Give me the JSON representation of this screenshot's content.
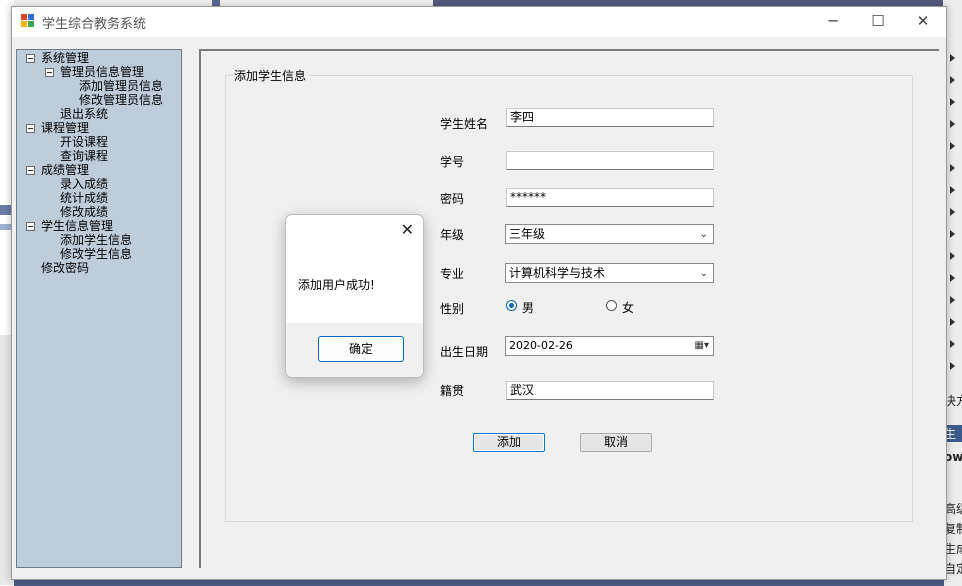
{
  "window": {
    "title": "学生综合教务系统",
    "minimize": "─",
    "maximize": "☐",
    "close": "✕"
  },
  "tree": {
    "nodes": [
      {
        "label": "系统管理"
      },
      {
        "label": "管理员信息管理"
      },
      {
        "label": "添加管理员信息"
      },
      {
        "label": "修改管理员信息"
      },
      {
        "label": "退出系统"
      },
      {
        "label": "课程管理"
      },
      {
        "label": "开设课程"
      },
      {
        "label": "查询课程"
      },
      {
        "label": "成绩管理"
      },
      {
        "label": "录入成绩"
      },
      {
        "label": "统计成绩"
      },
      {
        "label": "修改成绩"
      },
      {
        "label": "学生信息管理"
      },
      {
        "label": "添加学生信息"
      },
      {
        "label": "修改学生信息"
      },
      {
        "label": "修改密码"
      }
    ]
  },
  "form": {
    "group_title": "添加学生信息",
    "name_label": "学生姓名",
    "name_value": "李四",
    "id_label": "学号",
    "id_value": "",
    "password_label": "密码",
    "password_value": "******",
    "grade_label": "年级",
    "grade_value": "三年级",
    "major_label": "专业",
    "major_value": "计算机科学与技术",
    "gender_label": "性别",
    "gender_male": "男",
    "gender_female": "女",
    "gender_selected": "男",
    "birth_label": "出生日期",
    "birth_value": "2020-02-26",
    "origin_label": "籍贯",
    "origin_value": "武汉",
    "add_button": "添加",
    "cancel_button": "取消"
  },
  "dialog": {
    "message": "添加用户成功!",
    "ok_button": "确定",
    "close": "✕"
  },
  "background": {
    "right_snippets": [
      "决方",
      "生",
      "ow",
      "高级",
      "复制",
      "生成",
      "自定"
    ]
  },
  "colors": {
    "tree_bg": "#bfcddb",
    "accent": "#0067c0"
  }
}
